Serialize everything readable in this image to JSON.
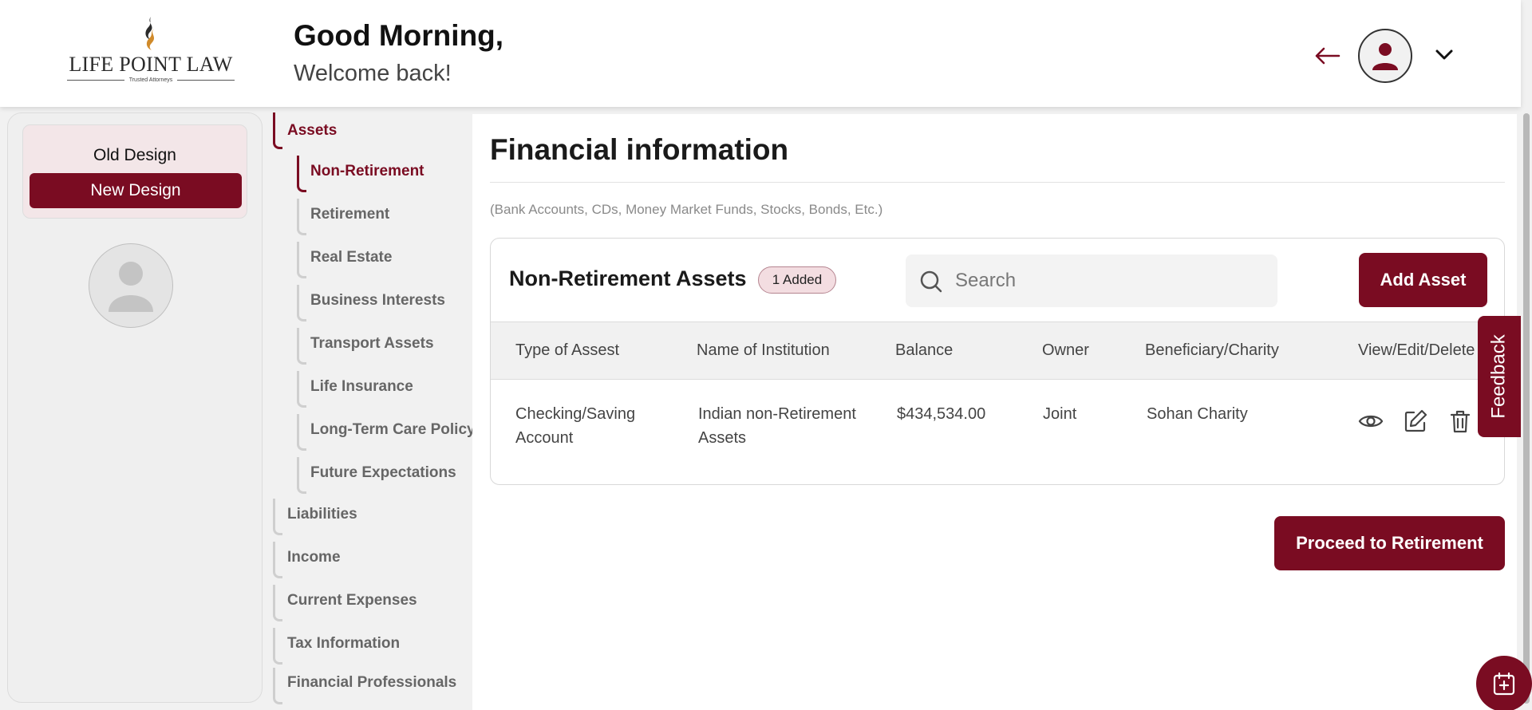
{
  "header": {
    "logo_name": "LIFE POINT LAW",
    "logo_tagline": "Trusted Attorneys",
    "greeting": "Good Morning,",
    "welcome": "Welcome back!"
  },
  "left_panel": {
    "old_design": "Old Design",
    "new_design": "New Design"
  },
  "nav": {
    "sections": [
      {
        "label": "Assets",
        "active": true
      },
      {
        "label": "Liabilities"
      },
      {
        "label": "Income"
      },
      {
        "label": "Current Expenses"
      },
      {
        "label": "Tax Information"
      },
      {
        "label": "Financial Professionals"
      }
    ],
    "sub_items": [
      {
        "label": "Non-Retirement",
        "active": true
      },
      {
        "label": "Retirement"
      },
      {
        "label": "Real Estate"
      },
      {
        "label": "Business Interests"
      },
      {
        "label": "Transport Assets"
      },
      {
        "label": "Life Insurance"
      },
      {
        "label": "Long-Term Care Policy"
      },
      {
        "label": "Future Expectations"
      }
    ]
  },
  "main": {
    "title": "Financial information",
    "subtitle": "(Bank Accounts, CDs, Money Market Funds, Stocks, Bonds, Etc.)",
    "card_title": "Non-Retirement Assets",
    "badge": "1 Added",
    "search_placeholder": "Search",
    "add_button": "Add Asset",
    "columns": [
      "Type of Assest",
      "Name of Institution",
      "Balance",
      "Owner",
      "Beneficiary/Charity",
      "View/Edit/Delete"
    ],
    "rows": [
      {
        "type": "Checking/Saving Account",
        "institution": "Indian non-Retirement Assets",
        "balance": "$434,534.00",
        "owner": "Joint",
        "beneficiary": "Sohan Charity"
      }
    ],
    "proceed_button": "Proceed to Retirement"
  },
  "feedback": "Feedback",
  "colors": {
    "brand": "#7a0c22",
    "badge_bg": "#f3dde1",
    "panel_bg": "#efefef"
  },
  "icons": {
    "back": "arrow-left-icon",
    "profile": "user-icon",
    "menu": "chevron-down-icon",
    "search": "search-icon",
    "view": "eye-icon",
    "edit": "edit-icon",
    "delete": "trash-icon",
    "fab": "calendar-plus-icon"
  }
}
